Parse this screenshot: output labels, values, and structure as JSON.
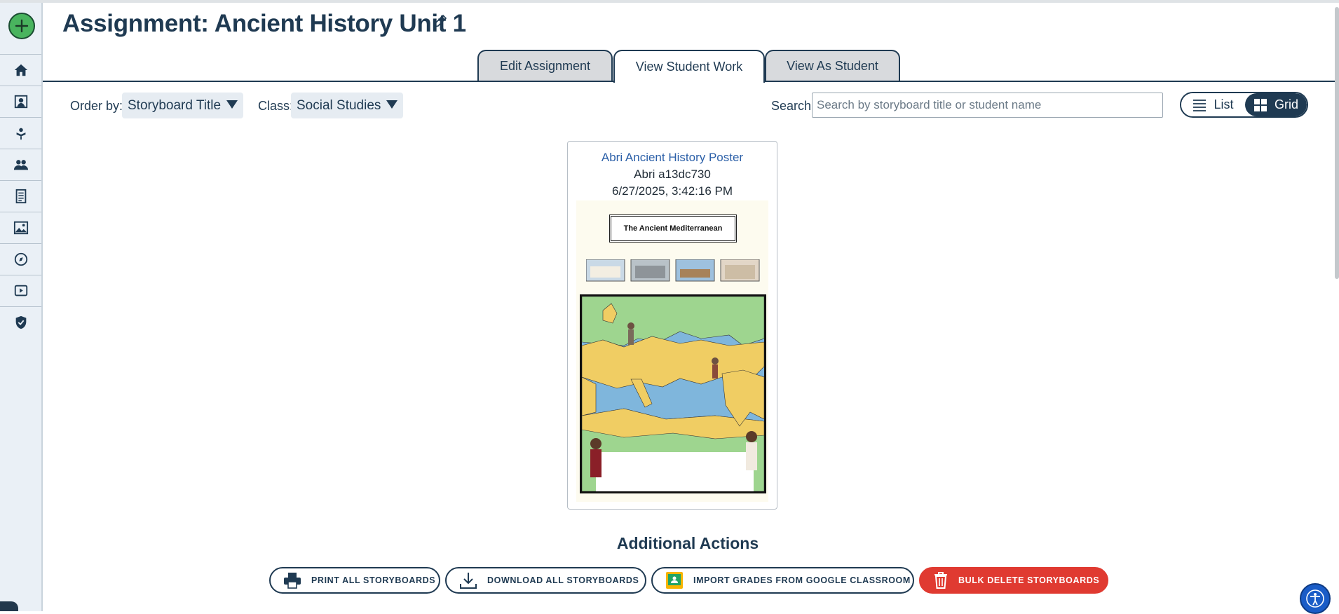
{
  "page": {
    "title": "Assignment: Ancient History Unit 1"
  },
  "tabs": [
    {
      "label": "Edit Assignment"
    },
    {
      "label": "View Student Work",
      "active": true
    },
    {
      "label": "View As Student"
    }
  ],
  "filters": {
    "order_label": "Order by:",
    "order_value": "Storyboard Title",
    "class_label": "Class:",
    "class_value": "Social Studies",
    "search_label": "Search:",
    "search_placeholder": "Search by storyboard title or student name"
  },
  "view_toggle": {
    "list_label": "List",
    "grid_label": "Grid",
    "selected": "Grid"
  },
  "cards": [
    {
      "title": "Abri Ancient History Poster",
      "student": "Abri a13dc730",
      "date": "6/27/2025, 3:42:16 PM",
      "poster_title": "The Ancient Mediterranean"
    }
  ],
  "additional_actions": {
    "heading": "Additional Actions",
    "buttons": [
      {
        "label": "PRINT ALL STORYBOARDS",
        "icon": "printer-icon"
      },
      {
        "label": "DOWNLOAD ALL STORYBOARDS",
        "icon": "download-icon"
      },
      {
        "label": "IMPORT GRADES FROM GOOGLE CLASSROOM",
        "icon": "google-classroom-icon"
      },
      {
        "label": "BULK DELETE STORYBOARDS",
        "icon": "trash-icon"
      }
    ]
  },
  "sidebar": {
    "items": [
      "home-icon",
      "storyboard-icon",
      "teacher-icon",
      "users-icon",
      "document-icon",
      "image-icon",
      "compass-icon",
      "video-icon",
      "shield-icon"
    ]
  },
  "colors": {
    "primary": "#1f3a52",
    "add_button": "#49b45e",
    "danger": "#e03a31",
    "link": "#2c60a8",
    "accessibility": "#1a5cc7"
  }
}
